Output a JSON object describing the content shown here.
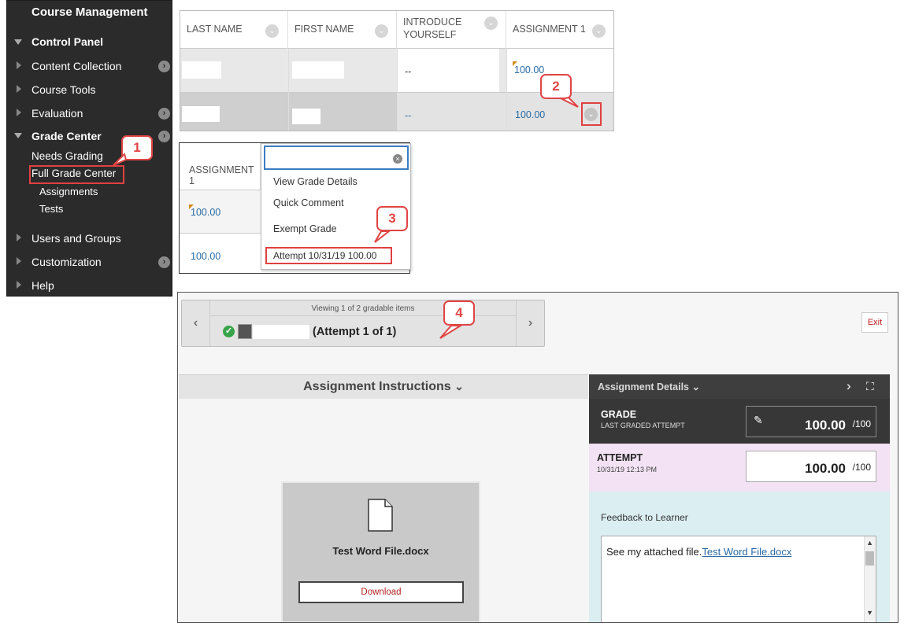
{
  "sidebar": {
    "title": "Course Management",
    "control_panel": "Control Panel",
    "items": {
      "content_collection": "Content Collection",
      "course_tools": "Course Tools",
      "evaluation": "Evaluation",
      "grade_center": "Grade Center",
      "needs_grading": "Needs Grading",
      "full_grade_center": "Full Grade Center",
      "assignments": "Assignments",
      "tests": "Tests",
      "users_and_groups": "Users and Groups",
      "customization": "Customization",
      "help": "Help"
    }
  },
  "callouts": [
    "1",
    "2",
    "3",
    "4"
  ],
  "grade_table": {
    "columns": [
      "LAST NAME",
      "FIRST NAME",
      "INTRODUCE YOURSELF",
      "ASSIGNMENT 1"
    ],
    "rows": [
      {
        "introduce": "--",
        "assignment1": "100.00"
      },
      {
        "introduce": "--",
        "assignment1": "100.00"
      }
    ]
  },
  "dropdown": {
    "column_header": "ASSIGNMENT 1",
    "values": [
      "100.00",
      "100.00"
    ],
    "search_placeholder": "",
    "menu_items": [
      "View Grade Details",
      "Quick Comment",
      "Exempt Grade",
      "Attempt 10/31/19 100.00"
    ]
  },
  "grading": {
    "viewing_text": "Viewing 1 of 2 gradable items",
    "attempt_label": "(Attempt 1 of 1)",
    "exit_label": "Exit",
    "instructions_title": "Assignment Instructions",
    "file_name": "Test Word File.docx",
    "download_label": "Download",
    "details_title": "Assignment Details",
    "grade_label": "GRADE",
    "grade_sub": "LAST GRADED ATTEMPT",
    "grade_value": "100.00",
    "grade_out_of": "/100",
    "attempt_title": "ATTEMPT",
    "attempt_time": "10/31/19 12:13 PM",
    "attempt_value": "100.00",
    "attempt_out_of": "/100",
    "feedback_label": "Feedback to Learner",
    "feedback_text": "See my attached file.",
    "feedback_link": "Test Word File.docx"
  },
  "colors": {
    "callout_red": "#e04545",
    "link_blue": "#2a6aa5",
    "sidebar_bg": "#2b2b2b",
    "success_green": "#37a44a"
  }
}
